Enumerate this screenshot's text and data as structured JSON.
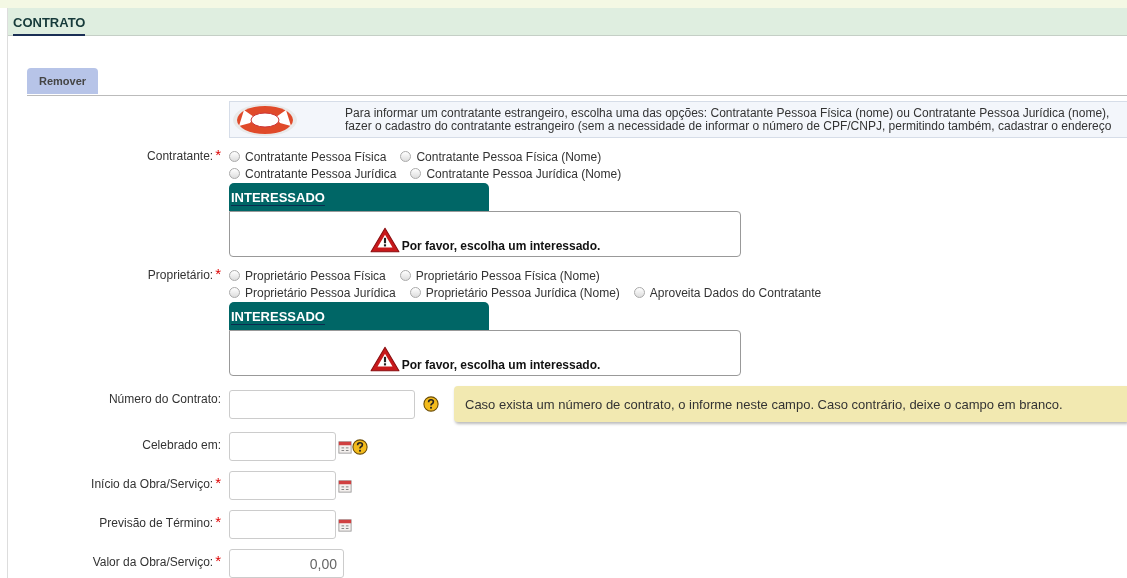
{
  "header": {
    "title": "CONTRATO"
  },
  "toolbar": {
    "buttons": [
      "Remover"
    ]
  },
  "info": {
    "lines": [
      "Para informar um contratante estrangeiro, escolha uma das opções: Contratante Pessoa Física (nome) ou Contratante Pessoa Jurídica (nome),",
      "fazer o cadastro do contratante estrangeiro (sem a necessidade de informar o número de CPF/CNPJ, permitindo também, cadastrar o endereço"
    ]
  },
  "required_mark": "*",
  "parties": [
    {
      "label": "Contratante:",
      "required": true,
      "option_rows": [
        [
          {
            "label": "Contratante Pessoa Física",
            "selected": false
          },
          {
            "label": "Contratante Pessoa Física (Nome)",
            "selected": false
          }
        ],
        [
          {
            "label": "Contratante Pessoa Jurídica",
            "selected": false
          },
          {
            "label": "Contratante Pessoa Jurídica (Nome)",
            "selected": false
          }
        ]
      ],
      "panel": {
        "title": "INTERESSADO",
        "message": "Por favor, escolha um interessado."
      }
    },
    {
      "label": "Proprietário:",
      "required": true,
      "option_rows": [
        [
          {
            "label": "Proprietário Pessoa Física",
            "selected": false
          },
          {
            "label": "Proprietário Pessoa Física (Nome)",
            "selected": false
          }
        ],
        [
          {
            "label": "Proprietário Pessoa Jurídica",
            "selected": false
          },
          {
            "label": "Proprietário Pessoa Jurídica (Nome)",
            "selected": false
          },
          {
            "label": "Aproveita Dados do Contratante",
            "selected": false
          }
        ]
      ],
      "panel": {
        "title": "INTERESSADO",
        "message": "Por favor, escolha um interessado."
      }
    }
  ],
  "fields": [
    {
      "label": "Número do Contrato:",
      "required": false,
      "kind": "text",
      "help": true,
      "tooltip": "Caso exista um número de contrato, o informe neste campo. Caso contrário, deixe o campo em branco."
    },
    {
      "label": "Celebrado em:",
      "required": false,
      "kind": "date",
      "help": true
    },
    {
      "label": "Início da Obra/Serviço:",
      "required": true,
      "kind": "date",
      "help": false
    },
    {
      "label": "Previsão de Término:",
      "required": true,
      "kind": "date",
      "help": false
    },
    {
      "label": "Valor da Obra/Serviço:",
      "required": true,
      "kind": "number",
      "help": false,
      "value": "0,00"
    }
  ]
}
